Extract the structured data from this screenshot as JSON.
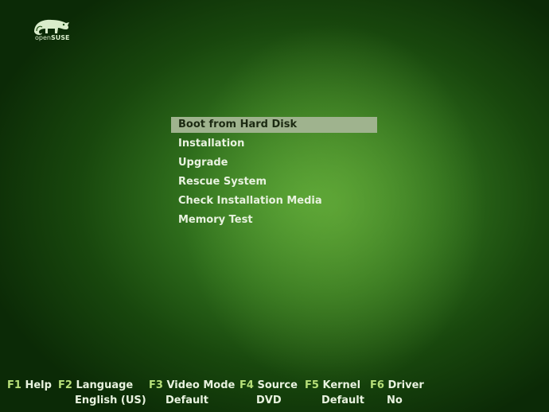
{
  "brand": {
    "logo_text_prefix": "open",
    "logo_text_suffix": "SUSE"
  },
  "menu": {
    "items": [
      {
        "label": "Boot from Hard Disk",
        "selected": true
      },
      {
        "label": "Installation",
        "selected": false
      },
      {
        "label": "Upgrade",
        "selected": false
      },
      {
        "label": "Rescue System",
        "selected": false
      },
      {
        "label": "Check Installation Media",
        "selected": false
      },
      {
        "label": "Memory Test",
        "selected": false
      }
    ]
  },
  "function_keys": [
    {
      "key": "F1",
      "label": "Help"
    },
    {
      "key": "F2",
      "label": "Language",
      "value": "English (US)"
    },
    {
      "key": "F3",
      "label": "Video Mode",
      "value": "Default"
    },
    {
      "key": "F4",
      "label": "Source",
      "value": "DVD"
    },
    {
      "key": "F5",
      "label": "Kernel",
      "value": "Default"
    },
    {
      "key": "F6",
      "label": "Driver",
      "value": "No"
    }
  ],
  "colors": {
    "key_accent": "#b7e079",
    "selection_bg": "#9fb38e",
    "text": "#e8f2df"
  }
}
